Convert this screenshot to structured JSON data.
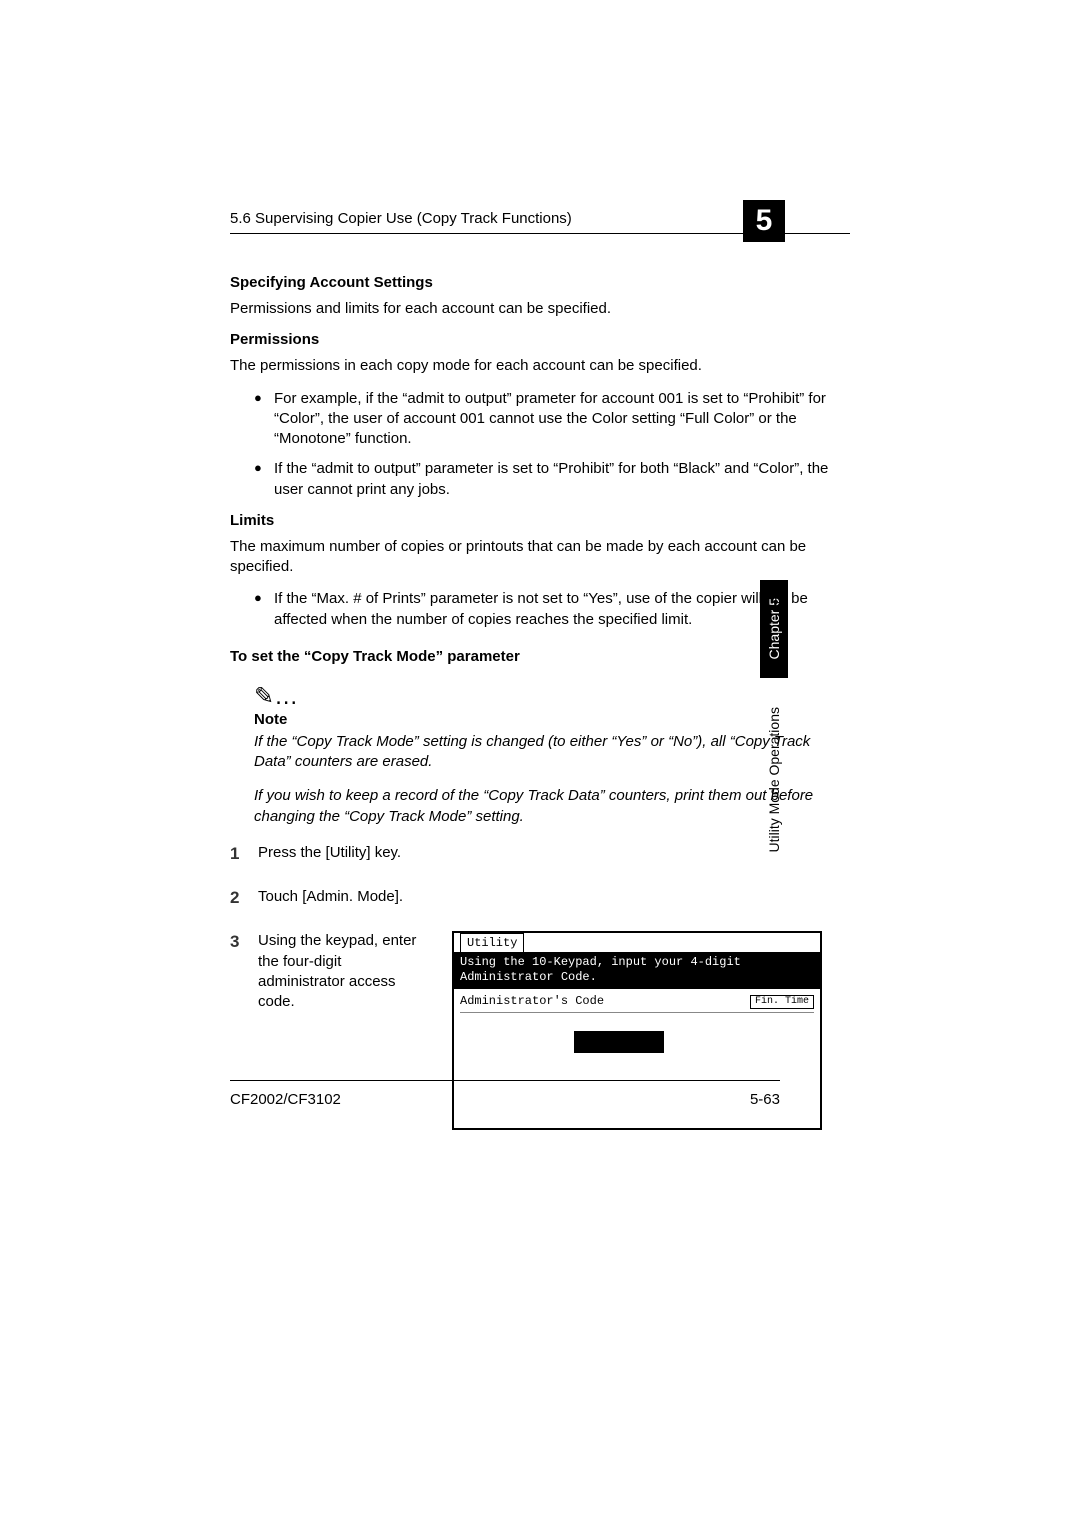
{
  "header": {
    "section_title": "5.6 Supervising Copier Use (Copy Track Functions)",
    "chapter_number": "5"
  },
  "sidebar": {
    "chapter_label": "Chapter 5",
    "section_label": "Utility Mode Operations"
  },
  "content": {
    "heading_account": "Specifying Account Settings",
    "account_intro": "Permissions and limits for each account can be specified.",
    "heading_permissions": "Permissions",
    "permissions_intro": "The permissions in each copy mode for each account can be specified.",
    "permissions_bullets": [
      "For example, if the “admit to output” prameter for account 001 is set to “Prohibit” for “Color”, the user of account 001 cannot use the Color setting “Full Color” or the “Monotone” function.",
      "If the “admit to output” parameter is set to “Prohibit” for both “Black” and “Color”, the user cannot print any jobs."
    ],
    "heading_limits": "Limits",
    "limits_intro": "The maximum number of copies or printouts that can be made by each account can be specified.",
    "limits_bullets": [
      "If the “Max. # of Prints” parameter is not set to “Yes”, use of the copier will not be affected when the number of copies reaches the specified limit."
    ],
    "heading_procedure": "To set the “Copy Track Mode” parameter",
    "note_icon": "✎…",
    "note_label": "Note",
    "note_body_1": "If the “Copy Track Mode” setting is changed (to either “Yes” or “No”), all “Copy Track Data” counters are erased.",
    "note_body_2": "If you wish to keep a record of the “Copy Track Data” counters, print them out before changing the “Copy Track Mode” setting.",
    "steps": [
      "Press the [Utility] key.",
      "Touch [Admin. Mode].",
      "Using the keypad, enter the four-digit administrator access code."
    ]
  },
  "lcd": {
    "tab": "Utility",
    "band_line1": "Using the 10-Keypad, input your 4-digit",
    "band_line2": "Administrator Code.",
    "row_label": "Administrator's Code",
    "button_label": "Fin.\nTime"
  },
  "footer": {
    "model": "CF2002/CF3102",
    "page": "5-63"
  }
}
